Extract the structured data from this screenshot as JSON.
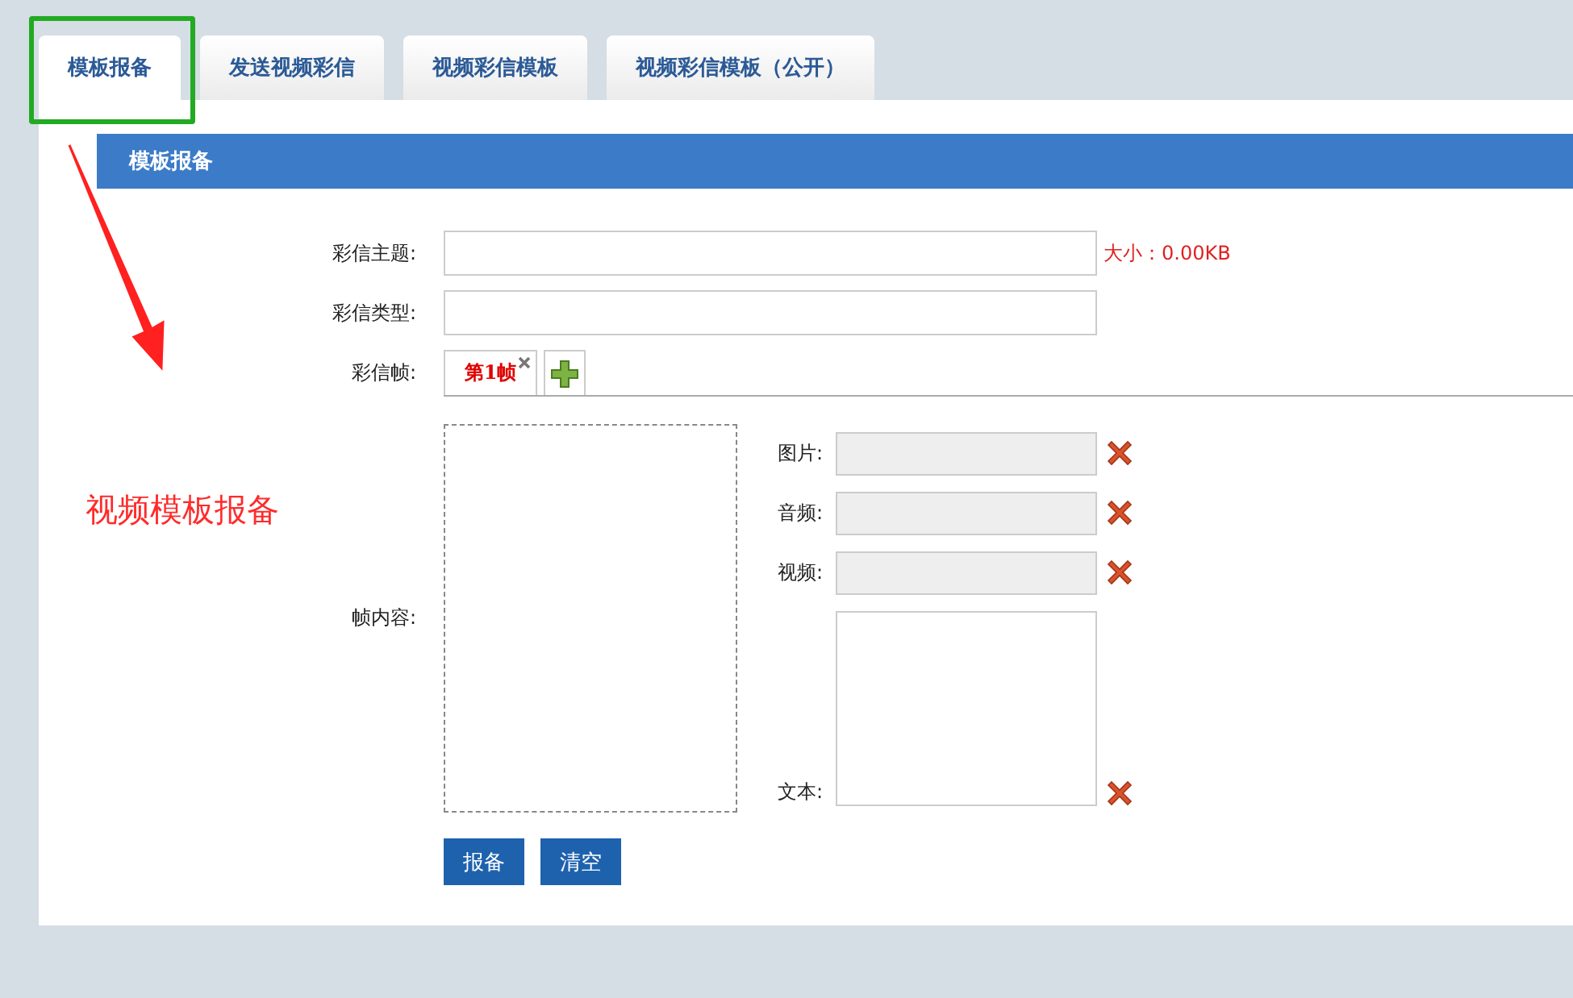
{
  "tabs": [
    {
      "label": "模板报备",
      "selected": true
    },
    {
      "label": "发送视频彩信",
      "selected": false
    },
    {
      "label": "视频彩信模板",
      "selected": false
    },
    {
      "label": "视频彩信模板（公开）",
      "selected": false
    }
  ],
  "panel": {
    "title": "模板报备"
  },
  "fields": [
    {
      "label": "彩信主题:",
      "note": "大小：0.00KB"
    },
    {
      "label": "彩信类型:"
    }
  ],
  "frames": {
    "label": "彩信帧:",
    "items": [
      {
        "label": "第1帧",
        "selected": true
      }
    ]
  },
  "frame_content": {
    "label": "帧内容:",
    "media": [
      {
        "kind": "input",
        "label": "图片:"
      },
      {
        "kind": "input",
        "label": "音频:"
      },
      {
        "kind": "input",
        "label": "视频:"
      },
      {
        "kind": "textarea",
        "label": "文本:"
      }
    ]
  },
  "buttons": [
    "报备",
    "清空"
  ],
  "annotation": {
    "text": "视频模板报备"
  }
}
